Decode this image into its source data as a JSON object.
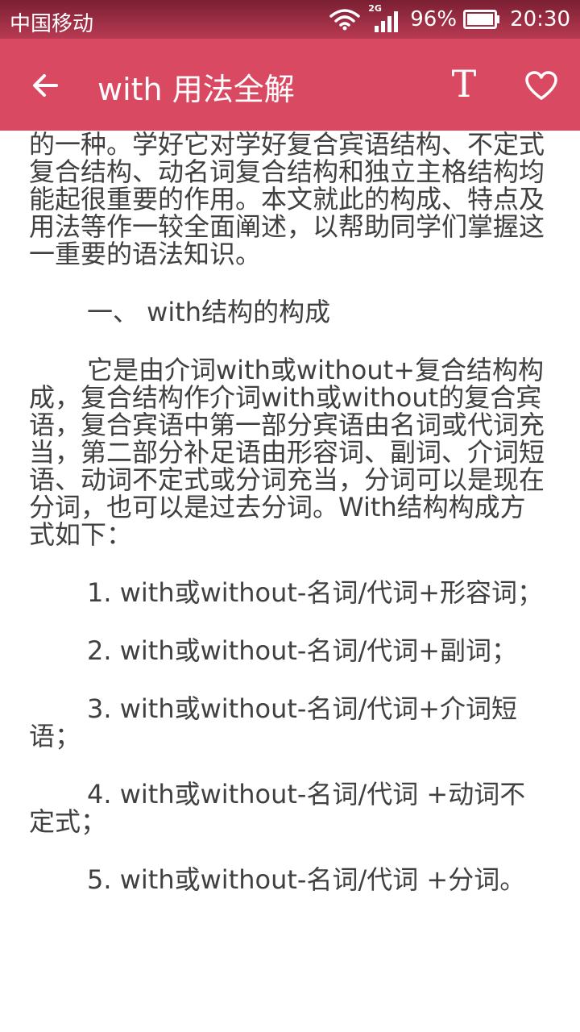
{
  "status_bar": {
    "carrier": "中国移动",
    "network": "2G",
    "battery": "96%",
    "time": "20:30"
  },
  "header": {
    "title": "with 用法全解"
  },
  "icons": {
    "back": "arrow-left-icon",
    "font_size": "text-size-icon",
    "favorite": "heart-outline-icon",
    "font_glyph": "T"
  },
  "colors": {
    "header_bg": "#d94a62",
    "status_bg": "#9a2a40",
    "text": "#404040"
  },
  "article": {
    "paragraphs": [
      "with结构是许多英语复合结构中最常用的一种。学好它对学好复合宾语结构、不定式复合结构、动名词复合结构和独立主格结构均能起很重要的作用。本文就此的构成、特点及用法等作一较全面阐述，以帮助同学们掌握这一重要的语法知识。",
      "一、 with结构的构成",
      "它是由介词with或without+复合结构构成，复合结构作介词with或without的复合宾语，复合宾语中第一部分宾语由名词或代词充当，第二部分补足语由形容词、副词、介词短语、动词不定式或分词充当，分词可以是现在分词，也可以是过去分词。With结构构成方式如下：",
      "1. with或without-名词/代词+形容词；",
      "2. with或without-名词/代词+副词；",
      "3. with或without-名词/代词+介词短语；",
      "4. with或without-名词/代词 +动词不定式；",
      "5. with或without-名词/代词 +分词。"
    ]
  }
}
